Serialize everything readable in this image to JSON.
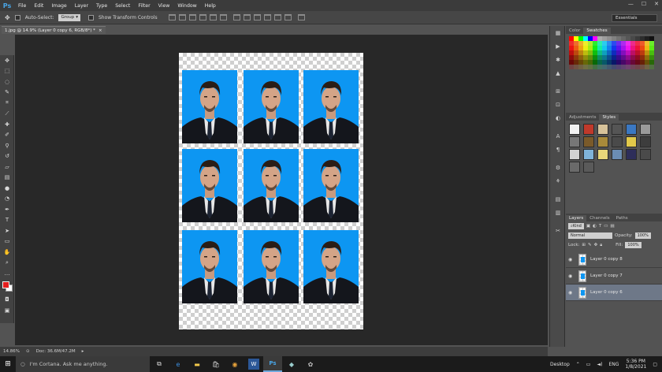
{
  "app": {
    "logo": "Ps"
  },
  "menu": [
    "File",
    "Edit",
    "Image",
    "Layer",
    "Type",
    "Select",
    "Filter",
    "View",
    "Window",
    "Help"
  ],
  "window_controls": {
    "minimize": "—",
    "maximize": "☐",
    "close": "✕"
  },
  "options": {
    "auto_select_label": "Auto-Select:",
    "auto_select_value": "Group",
    "show_transform_label": "Show Transform Controls",
    "workspace": "Essentials"
  },
  "document": {
    "tab_title": "1.jpg @ 14.9% (Layer 0 copy 6, RGB/8*) *",
    "close": "×"
  },
  "tools": [
    "move-icon",
    "marquee-icon",
    "lasso-icon",
    "quick-select-icon",
    "crop-icon",
    "eyedropper-icon",
    "healing-icon",
    "brush-icon",
    "stamp-icon",
    "history-brush-icon",
    "eraser-icon",
    "gradient-icon",
    "blur-icon",
    "dodge-icon",
    "pen-icon",
    "type-icon",
    "path-select-icon",
    "shape-icon",
    "hand-icon",
    "zoom-icon"
  ],
  "colors": {
    "foreground": "#e31e1e",
    "background": "#ffffff",
    "photo_bg": "#0d96f2"
  },
  "status": {
    "zoom": "14.86%",
    "doc_size": "Doc: 36.6M/47.2M"
  },
  "panels": {
    "color_tabs": [
      "Color",
      "Swatches"
    ],
    "adjust_tabs": [
      "Adjustments",
      "Styles"
    ],
    "layers_tabs": [
      "Layers",
      "Channels",
      "Paths"
    ],
    "kind_label": "Kind",
    "blend_mode": "Normal",
    "opacity_label": "Opacity:",
    "opacity_value": "100%",
    "lock_label": "Lock:",
    "fill_label": "Fill:",
    "fill_value": "100%",
    "layers": [
      {
        "name": "Layer 0 copy 8",
        "selected": false
      },
      {
        "name": "Layer 0 copy 7",
        "selected": false
      },
      {
        "name": "Layer 0 copy 6",
        "selected": true
      }
    ]
  },
  "taskbar": {
    "cortana": "I'm Cortana. Ask me anything.",
    "desktop_label": "Desktop",
    "language": "ENG",
    "time": "5:36 PM",
    "date": "1/8/2021"
  }
}
